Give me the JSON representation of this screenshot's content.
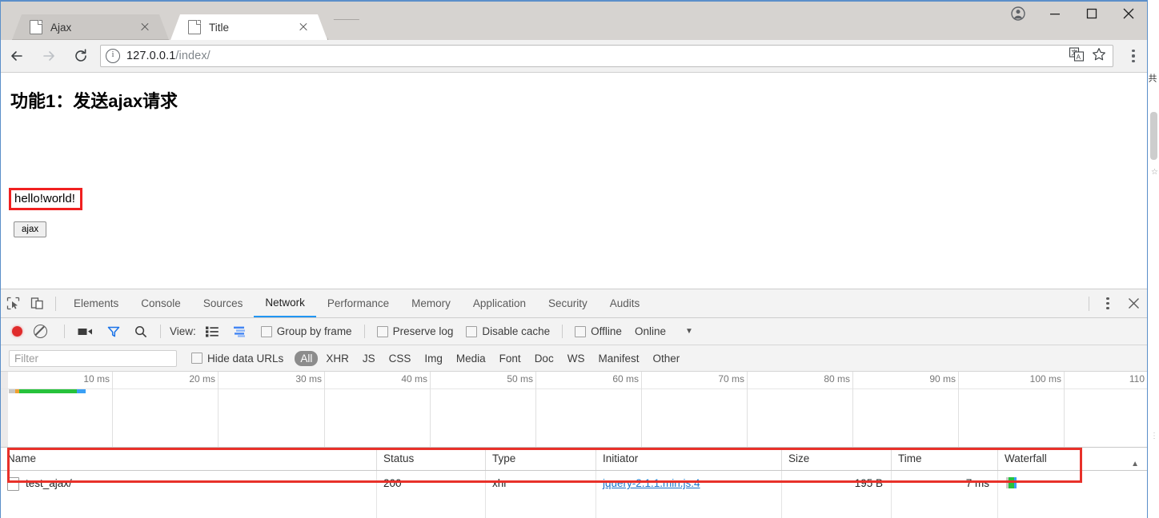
{
  "window": {
    "tabs": [
      {
        "title": "Ajax",
        "active": false
      },
      {
        "title": "Title",
        "active": true
      }
    ],
    "controls": {
      "profile": "profile-icon",
      "minimize": "–",
      "maximize": "□",
      "close": "✕"
    },
    "omnibox": {
      "url_host": "127.0.0.1",
      "url_path": "/index/",
      "full_url": "127.0.0.1/index/"
    }
  },
  "page": {
    "heading": "功能1：发送ajax请求",
    "result_text": "hello!world!",
    "button_label": "ajax"
  },
  "devtools": {
    "tabs": [
      {
        "label": "Elements",
        "active": false
      },
      {
        "label": "Console",
        "active": false
      },
      {
        "label": "Sources",
        "active": false
      },
      {
        "label": "Network",
        "active": true
      },
      {
        "label": "Performance",
        "active": false
      },
      {
        "label": "Memory",
        "active": false
      },
      {
        "label": "Application",
        "active": false
      },
      {
        "label": "Security",
        "active": false
      },
      {
        "label": "Audits",
        "active": false
      }
    ],
    "network_toolbar": {
      "view_label": "View:",
      "group_by_frame": "Group by frame",
      "preserve_log": "Preserve log",
      "disable_cache": "Disable cache",
      "offline": "Offline",
      "throttling": "Online"
    },
    "filter_bar": {
      "filter_placeholder": "Filter",
      "hide_data_urls": "Hide data URLs",
      "types": [
        "All",
        "XHR",
        "JS",
        "CSS",
        "Img",
        "Media",
        "Font",
        "Doc",
        "WS",
        "Manifest",
        "Other"
      ],
      "selected_type": "All"
    },
    "overview": {
      "ticks": [
        "10 ms",
        "20 ms",
        "30 ms",
        "40 ms",
        "50 ms",
        "60 ms",
        "70 ms",
        "80 ms",
        "90 ms",
        "100 ms",
        "110"
      ]
    },
    "table": {
      "columns": [
        "Name",
        "Status",
        "Type",
        "Initiator",
        "Size",
        "Time",
        "Waterfall"
      ],
      "sort_indicator": "▲",
      "rows": [
        {
          "name": "test_ajax/",
          "status": "200",
          "type": "xhr",
          "initiator": "jquery-2.1.1.min.js:4",
          "size": "195 B",
          "time": "7 ms"
        }
      ]
    }
  },
  "colors": {
    "accent": "#2196f3",
    "record_red": "#e02b2b",
    "highlight_red": "#e8312a",
    "link_blue": "#1a73c9",
    "waterfall_green": "#27c23c",
    "waterfall_blue": "#3aa0f5"
  }
}
